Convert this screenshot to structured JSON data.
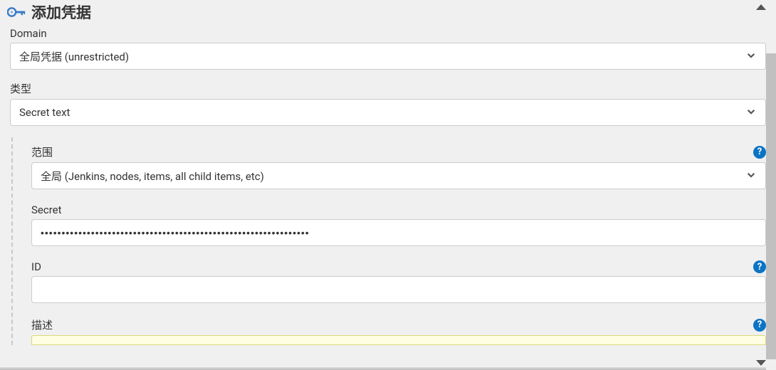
{
  "header": {
    "title": "添加凭据"
  },
  "form": {
    "domain": {
      "label": "Domain",
      "value": "全局凭据 (unrestricted)"
    },
    "type": {
      "label": "类型",
      "value": "Secret text"
    },
    "scope": {
      "label": "范围",
      "value": "全局 (Jenkins, nodes, items, all child items, etc)"
    },
    "secret": {
      "label": "Secret",
      "value": "••••••••••••••••••••••••••••••••••••••••••••••••••••••••••••••••"
    },
    "id": {
      "label": "ID",
      "value": ""
    },
    "description": {
      "label": "描述",
      "value": ""
    }
  },
  "icons": {
    "help": "?"
  }
}
